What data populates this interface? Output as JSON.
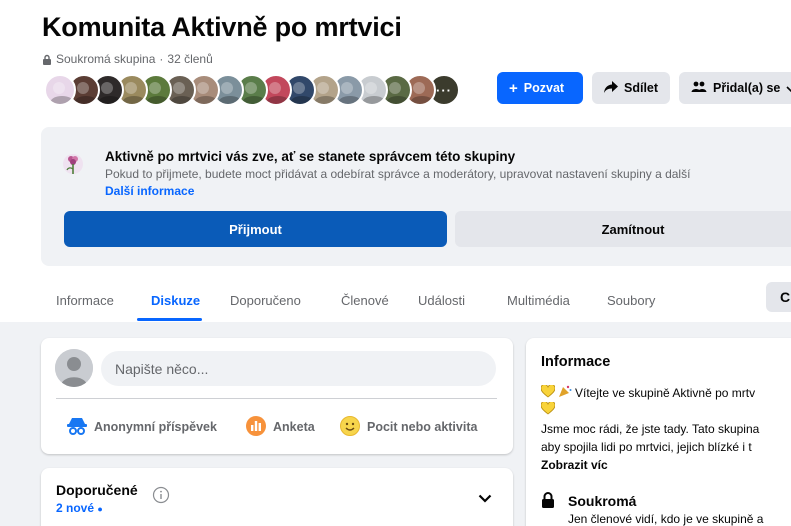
{
  "group": {
    "title": "Komunita Aktivně po mrtvici",
    "privacy_label": "Soukromá skupina",
    "separator": "·",
    "members": "32 členů",
    "avatar_colors": [
      "#e8d7e9",
      "#5b3d34",
      "#2e2a2a",
      "#9a8a5e",
      "#5c7a3c",
      "#6a6054",
      "#a88c7a",
      "#7b8f9a",
      "#5a7d4a",
      "#c2485c",
      "#31486a",
      "#b3a38a",
      "#8a9aa8",
      "#c8ccd0",
      "#5a6a44",
      "#9d6a56",
      "#3b3b2d"
    ],
    "more_avatar": "···"
  },
  "actions": {
    "invite": "Pozvat",
    "invite_prefix": "+",
    "share": "Sdílet",
    "joined": "Přidal(a) se"
  },
  "banner": {
    "title": "Aktivně po mrtvici vás zve, ať se stanete správcem této skupiny",
    "text": "Pokud to přijmete, budete moct přidávat a odebírat správce a moderátory, upravovat nastavení skupiny a další",
    "link": "Další informace",
    "accept": "Přijmout",
    "decline": "Zamítnout"
  },
  "tabs": [
    {
      "label": "Informace"
    },
    {
      "label": "Diskuze"
    },
    {
      "label": "Doporučeno"
    },
    {
      "label": "Členové"
    },
    {
      "label": "Události"
    },
    {
      "label": "Multimédia"
    },
    {
      "label": "Soubory"
    }
  ],
  "tabs_active": "Diskuze",
  "tabs_more": "C",
  "composer": {
    "placeholder": "Napište něco...",
    "anonymous": "Anonymní příspěvek",
    "poll": "Anketa",
    "feeling": "Pocit nebo aktivita"
  },
  "recommended": {
    "title": "Doporučené",
    "new_count": "2 nové",
    "dot": "●"
  },
  "info": {
    "title": "Informace",
    "welcome": "Vítejte ve skupině Aktivně po mrtv",
    "line2": "Jsme moc rádi, že jste tady. Tato skupina",
    "line3": "aby spojila lidi po mrtvici, jejich blízké i t",
    "more": "Zobrazit víc",
    "private_title": "Soukromá",
    "private_text": "Jen členové vidí, kdo je ve skupině a"
  },
  "colors": {
    "primary": "#0866ff",
    "accept": "#0a5bb8",
    "secondary_bg": "#e4e6eb",
    "page_bg": "#f0f2f5",
    "muted_text": "#65676b"
  }
}
